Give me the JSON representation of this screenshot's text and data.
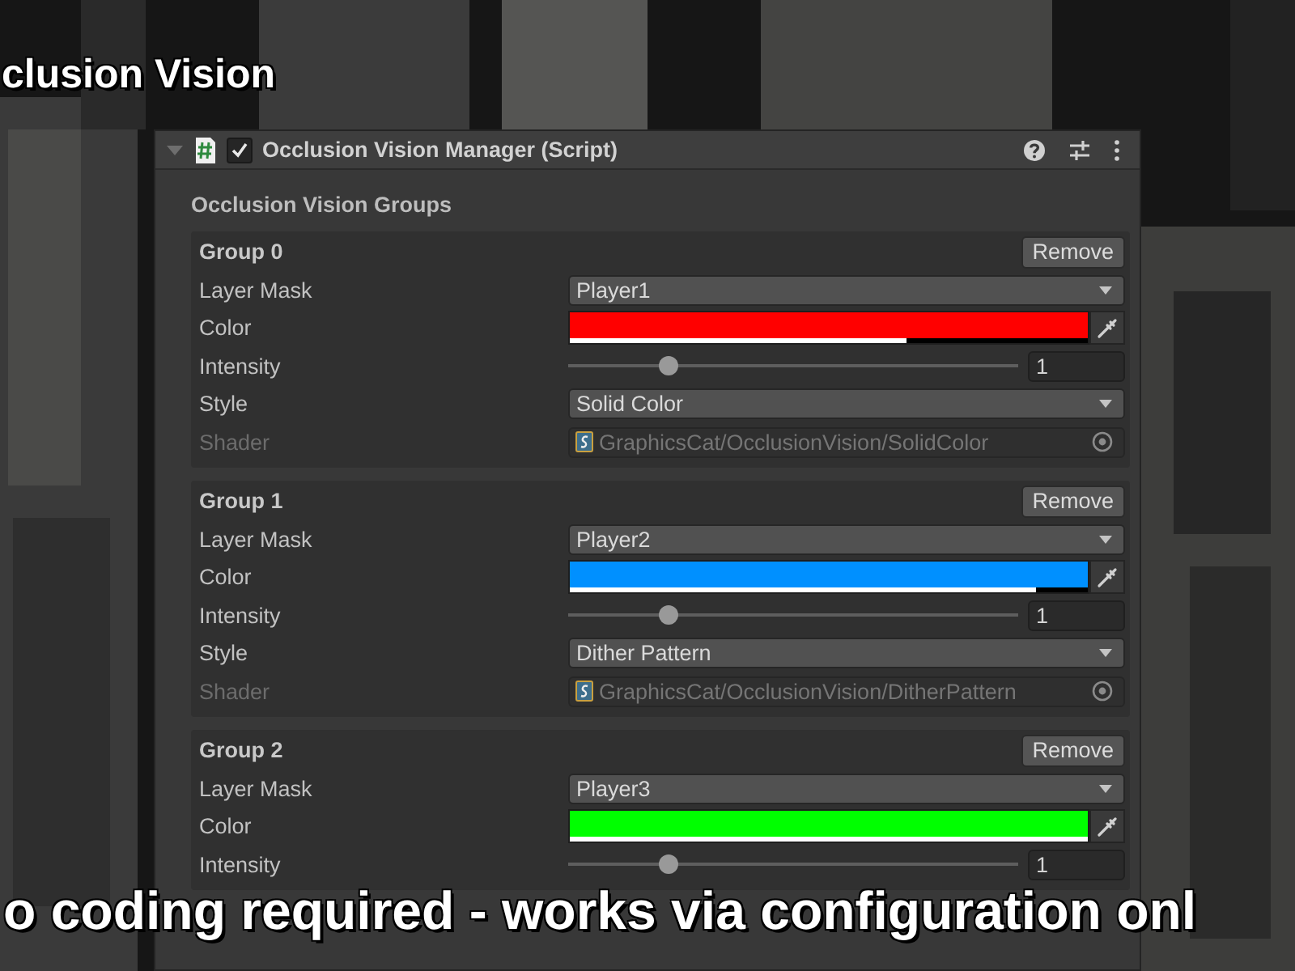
{
  "caption_top": "clusion Vision",
  "component": {
    "title": "Occlusion Vision Manager (Script)",
    "enabled": true,
    "expanded": true
  },
  "section_title": "Occlusion Vision Groups",
  "groups": [
    {
      "title": "Group 0",
      "remove_button": "Remove",
      "fields": [
        {
          "kind": "dropdown",
          "label": "Layer Mask",
          "value": "Player1"
        },
        {
          "kind": "color",
          "label": "Color",
          "color": "#ff0000",
          "level": 0.65
        },
        {
          "kind": "slider",
          "label": "Intensity",
          "level": 0.21,
          "value": "1"
        },
        {
          "kind": "dropdown",
          "label": "Style",
          "value": "Solid Color"
        },
        {
          "kind": "object",
          "label": "Shader",
          "value": "GraphicsCat/OcclusionVision/SolidColor",
          "disabled": true
        }
      ]
    },
    {
      "title": "Group 1",
      "remove_button": "Remove",
      "fields": [
        {
          "kind": "dropdown",
          "label": "Layer Mask",
          "value": "Player2"
        },
        {
          "kind": "color",
          "label": "Color",
          "color": "#0090ff",
          "level": 0.9
        },
        {
          "kind": "slider",
          "label": "Intensity",
          "level": 0.21,
          "value": "1"
        },
        {
          "kind": "dropdown",
          "label": "Style",
          "value": "Dither Pattern"
        },
        {
          "kind": "object",
          "label": "Shader",
          "value": "GraphicsCat/OcclusionVision/DitherPattern",
          "disabled": true
        }
      ]
    },
    {
      "title": "Group 2",
      "remove_button": "Remove",
      "fields": [
        {
          "kind": "dropdown",
          "label": "Layer Mask",
          "value": "Player3"
        },
        {
          "kind": "color",
          "label": "Color",
          "color": "#00ff00",
          "level": 1
        },
        {
          "kind": "slider",
          "label": "Intensity",
          "level": 0.21,
          "value": "1"
        }
      ]
    }
  ],
  "caption_bottom": "o coding required - works via configuration onl"
}
